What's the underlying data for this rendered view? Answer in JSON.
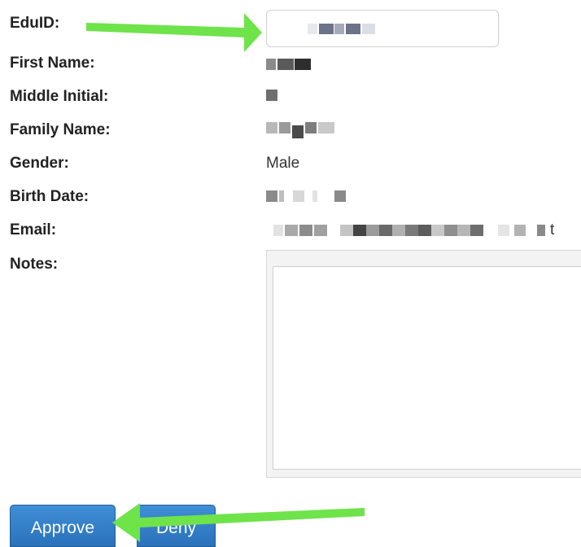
{
  "form": {
    "fields": [
      {
        "label": "EduID:"
      },
      {
        "label": "First Name:"
      },
      {
        "label": "Middle Initial:"
      },
      {
        "label": "Family Name:"
      },
      {
        "label": "Gender:",
        "value": "Male"
      },
      {
        "label": "Birth Date:"
      },
      {
        "label": "Email:",
        "value_visible_tail": "t"
      },
      {
        "label": "Notes:"
      }
    ]
  },
  "buttons": {
    "approve_label": "Approve",
    "deny_label": "Deny"
  },
  "colors": {
    "button_blue": "#2f7bc7",
    "arrow_green": "#6fe34a",
    "redaction_gray": "#7a7a7a"
  }
}
